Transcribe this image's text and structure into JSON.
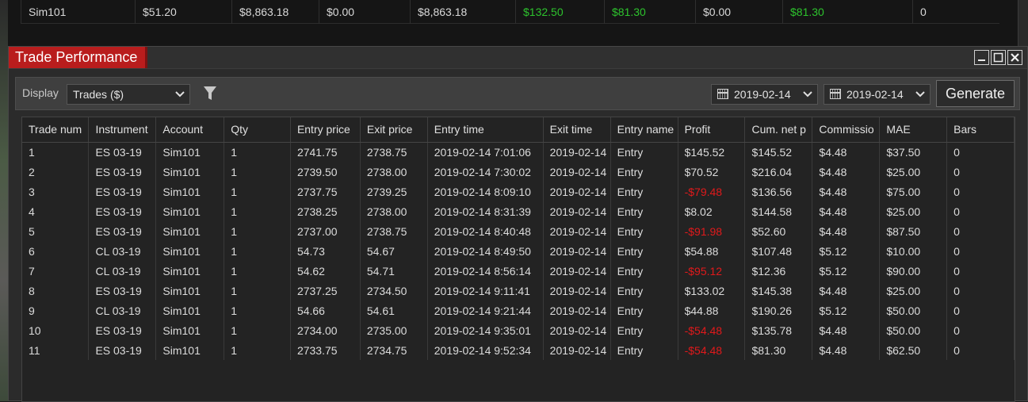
{
  "account_row": {
    "cells": [
      {
        "text": "Sim101",
        "color": ""
      },
      {
        "text": "$51.20",
        "color": ""
      },
      {
        "text": "$8,863.18",
        "color": ""
      },
      {
        "text": "$0.00",
        "color": ""
      },
      {
        "text": "$8,863.18",
        "color": ""
      },
      {
        "text": "$132.50",
        "color": "#2dc32d"
      },
      {
        "text": "$81.30",
        "color": "#2dc32d"
      },
      {
        "text": "$0.00",
        "color": ""
      },
      {
        "text": "$81.30",
        "color": "#2dc32d"
      },
      {
        "text": "0",
        "color": ""
      }
    ]
  },
  "window": {
    "title": "Trade Performance",
    "buttons": [
      "minimize-icon",
      "maximize-icon",
      "close-icon"
    ]
  },
  "toolbar": {
    "display_label": "Display",
    "display_value": "Trades ($)",
    "filter_icon": "filter-icon",
    "start_date": "2019-02-14",
    "end_date": "2019-02-14",
    "generate_label": "Generate"
  },
  "table": {
    "columns": [
      "Trade num",
      "Instrument",
      "Account",
      "Qty",
      "Entry price",
      "Exit price",
      "Entry time",
      "Exit time",
      "Entry name",
      "Profit",
      "Cum. net p",
      "Commissio",
      "MAE",
      "Bars"
    ],
    "rows": [
      [
        "1",
        "ES 03-19",
        "Sim101",
        "1",
        "2741.75",
        "2738.75",
        "2019-02-14 7:01:06",
        "2019-02-14",
        "Entry",
        "$145.52",
        "$145.52",
        "$4.48",
        "$37.50",
        "0"
      ],
      [
        "2",
        "ES 03-19",
        "Sim101",
        "1",
        "2739.50",
        "2738.00",
        "2019-02-14 7:30:02",
        "2019-02-14",
        "Entry",
        "$70.52",
        "$216.04",
        "$4.48",
        "$25.00",
        "0"
      ],
      [
        "3",
        "ES 03-19",
        "Sim101",
        "1",
        "2737.75",
        "2739.25",
        "2019-02-14 8:09:10",
        "2019-02-14",
        "Entry",
        "-$79.48",
        "$136.56",
        "$4.48",
        "$75.00",
        "0"
      ],
      [
        "4",
        "ES 03-19",
        "Sim101",
        "1",
        "2738.25",
        "2738.00",
        "2019-02-14 8:31:39",
        "2019-02-14",
        "Entry",
        "$8.02",
        "$144.58",
        "$4.48",
        "$25.00",
        "0"
      ],
      [
        "5",
        "ES 03-19",
        "Sim101",
        "1",
        "2737.00",
        "2738.75",
        "2019-02-14 8:40:48",
        "2019-02-14",
        "Entry",
        "-$91.98",
        "$52.60",
        "$4.48",
        "$87.50",
        "0"
      ],
      [
        "6",
        "CL 03-19",
        "Sim101",
        "1",
        "54.73",
        "54.67",
        "2019-02-14 8:49:50",
        "2019-02-14",
        "Entry",
        "$54.88",
        "$107.48",
        "$5.12",
        "$10.00",
        "0"
      ],
      [
        "7",
        "CL 03-19",
        "Sim101",
        "1",
        "54.62",
        "54.71",
        "2019-02-14 8:56:14",
        "2019-02-14",
        "Entry",
        "-$95.12",
        "$12.36",
        "$5.12",
        "$90.00",
        "0"
      ],
      [
        "8",
        "ES 03-19",
        "Sim101",
        "1",
        "2737.25",
        "2734.50",
        "2019-02-14 9:11:41",
        "2019-02-14",
        "Entry",
        "$133.02",
        "$145.38",
        "$4.48",
        "$25.00",
        "0"
      ],
      [
        "9",
        "CL 03-19",
        "Sim101",
        "1",
        "54.66",
        "54.61",
        "2019-02-14 9:21:44",
        "2019-02-14",
        "Entry",
        "$44.88",
        "$190.26",
        "$5.12",
        "$50.00",
        "0"
      ],
      [
        "10",
        "ES 03-19",
        "Sim101",
        "1",
        "2734.00",
        "2735.00",
        "2019-02-14 9:35:01",
        "2019-02-14",
        "Entry",
        "-$54.48",
        "$135.78",
        "$4.48",
        "$50.00",
        "0"
      ],
      [
        "11",
        "ES 03-19",
        "Sim101",
        "1",
        "2733.75",
        "2734.75",
        "2019-02-14 9:52:34",
        "2019-02-14",
        "Entry",
        "-$54.48",
        "$81.30",
        "$4.48",
        "$62.50",
        "0"
      ]
    ],
    "negative_color": "#e0191b"
  }
}
